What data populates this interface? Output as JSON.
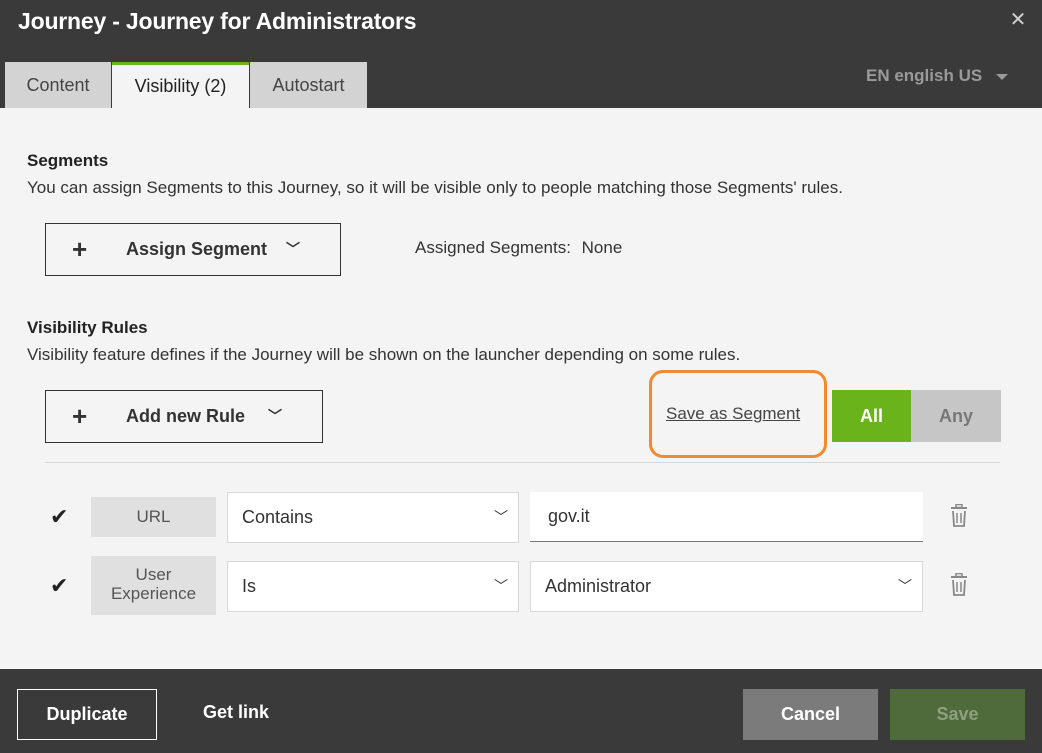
{
  "header": {
    "title": "Journey - Journey for Administrators",
    "close_icon": "close-icon",
    "tabs": [
      {
        "label": "Content"
      },
      {
        "label": "Visibility (2)"
      },
      {
        "label": "Autostart"
      }
    ],
    "active_tab": "Visibility (2)",
    "language": "EN english US"
  },
  "segments": {
    "title": "Segments",
    "description": "You can assign Segments to this Journey, so it will be visible only to people matching those Segments' rules.",
    "assign_button": "Assign Segment",
    "assigned_label": "Assigned Segments:",
    "assigned_value": "None"
  },
  "visibility": {
    "title": "Visibility Rules",
    "description": "Visibility feature defines if the Journey will be shown on the launcher depending on some rules.",
    "add_button": "Add new Rule",
    "save_as_segment": "Save as Segment",
    "match_options": {
      "all": "All",
      "any": "Any"
    },
    "selected_match": "All",
    "rules": [
      {
        "attribute": "URL",
        "operator": "Contains",
        "value": "gov.it",
        "value_type": "text"
      },
      {
        "attribute": "User Experience",
        "operator": "Is",
        "value": "Administrator",
        "value_type": "select"
      }
    ]
  },
  "footer": {
    "duplicate": "Duplicate",
    "get_link": "Get link",
    "cancel": "Cancel",
    "save": "Save"
  },
  "colors": {
    "header_bg": "#3a3a3a",
    "accent_green": "#6ab31b",
    "highlight_orange": "#f28a2d",
    "save_disabled": "#4f6a3b"
  }
}
